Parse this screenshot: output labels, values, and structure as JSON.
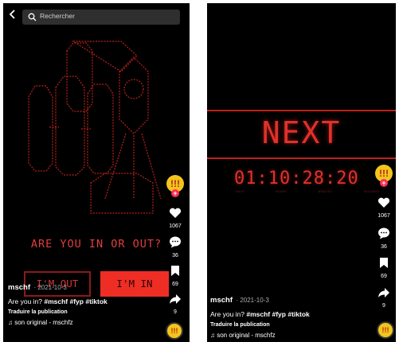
{
  "left": {
    "search": {
      "placeholder": "Rechercher",
      "back_icon": "chevron-left-icon",
      "search_icon": "search-icon"
    },
    "question": "ARE YOU IN OR OUT?",
    "buttons": {
      "out_label": "I'M OUT",
      "in_label": "I'M IN"
    },
    "creator_avatar": "!!!",
    "rail": {
      "likes": "1067",
      "comments": "36",
      "saves": "69",
      "shares": "9"
    },
    "post": {
      "username": "mschf",
      "date": "· 2021-10-3",
      "caption_text": "Are you in?",
      "hashtags": "#mschf #fyp #tiktok",
      "translate": "Traduire la publication",
      "sound": "son original - mschfz"
    },
    "disc_label": "!!!"
  },
  "right": {
    "next_label": "NEXT",
    "timer": "01:10:28:20",
    "timer_units": [
      "DAYS",
      "HOURS",
      "MINUTES",
      "SECONDS"
    ],
    "creator_avatar": "!!!",
    "rail": {
      "likes": "1067",
      "comments": "36",
      "saves": "69",
      "shares": "9"
    },
    "post": {
      "username": "mschf",
      "date": "· 2021-10-3",
      "caption_text": "Are you in?",
      "hashtags": "#mschf #fyp #tiktok",
      "translate": "Traduire la publication",
      "sound": "son original - mschfz"
    },
    "disc_label": "!!!"
  },
  "colors": {
    "accent_red": "#ee2e25",
    "like_pink": "#fe2c55",
    "avatar_yellow": "#f3c51c",
    "background": "#000000"
  }
}
